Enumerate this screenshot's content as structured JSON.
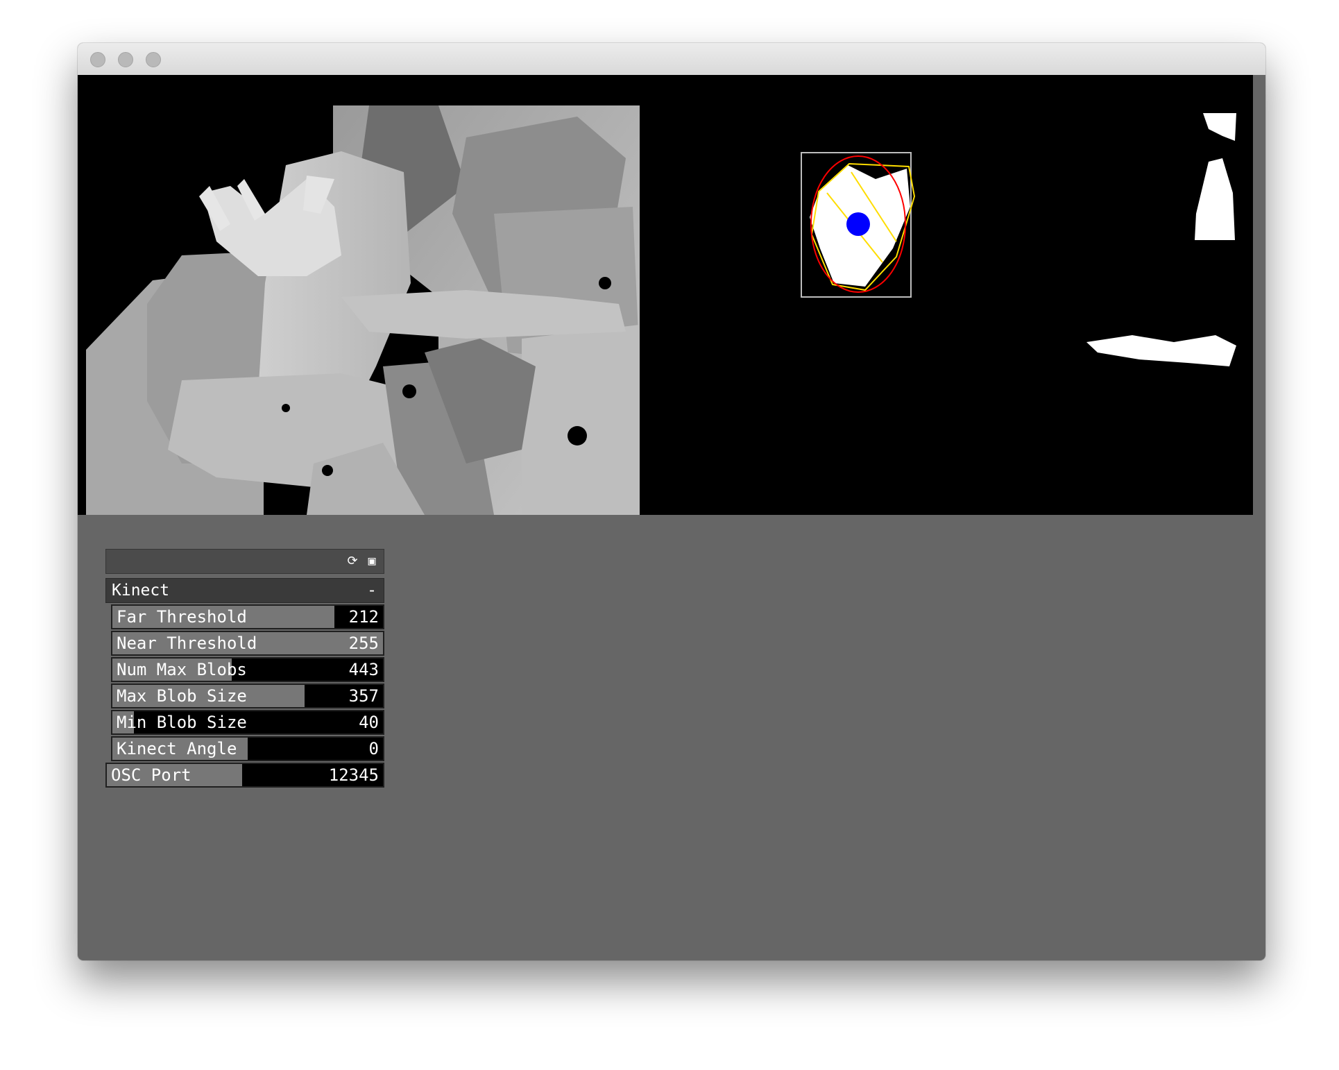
{
  "window": {
    "traffic_lights": [
      "close",
      "minimize",
      "zoom"
    ]
  },
  "canvas": {
    "views": [
      "depth-image",
      "thresholded-blob-image"
    ],
    "blob_marker_color": "#0000ff",
    "hull_color": "#ffff00",
    "ellipse_color": "#ff0000"
  },
  "gui": {
    "header_icons": [
      "reload-icon",
      "save-icon"
    ],
    "group": {
      "title": "Kinect",
      "collapse_symbol": "-"
    },
    "sliders": [
      {
        "label": "Far Threshold",
        "value": "212",
        "level": 0.82
      },
      {
        "label": "Near Threshold",
        "value": "255",
        "level": 1.0
      },
      {
        "label": "Num Max Blobs",
        "value": "443",
        "level": 0.44
      },
      {
        "label": "Max Blob Size",
        "value": "357",
        "level": 0.71
      },
      {
        "label": "Min Blob Size",
        "value": "40",
        "level": 0.08
      },
      {
        "label": "Kinect Angle",
        "value": "0",
        "level": 0.5
      }
    ],
    "osc": {
      "label": "OSC Port",
      "value": "12345",
      "level": 0.49
    }
  }
}
